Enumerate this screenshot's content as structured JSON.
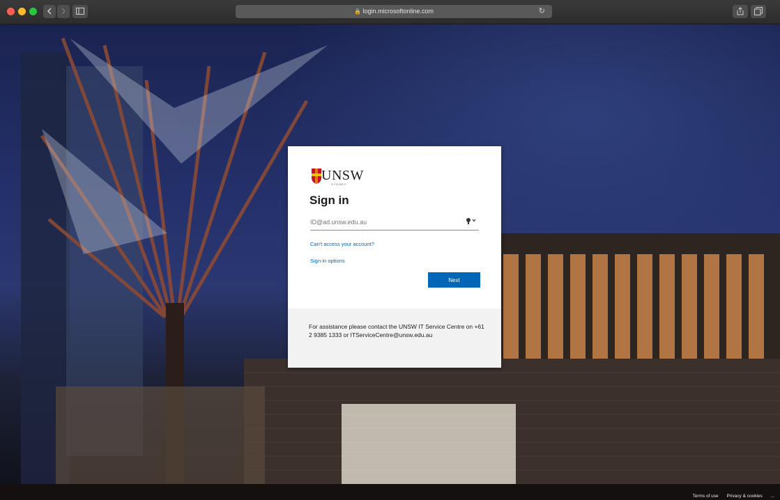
{
  "browser": {
    "url": "login.microsoftonline.com",
    "back_icon": "chevron-left",
    "forward_icon": "chevron-right",
    "sidebar_icon": "sidebar",
    "reload_icon": "reload",
    "share_icon": "share",
    "tabs_icon": "tabs"
  },
  "login": {
    "brand": "UNSW",
    "brand_sub": "SYDNEY",
    "title": "Sign in",
    "email_placeholder": "ID@ad.unsw.edu.au",
    "cant_access": "Can't access your account?",
    "signin_options": "Sign-in options",
    "next": "Next",
    "assistance": "For assistance please contact the UNSW IT Service Centre on +61 2 9385 1333 or ITServiceCentre@unsw.edu.au"
  },
  "footer": {
    "terms": "Terms of use",
    "privacy": "Privacy & cookies",
    "more": "..."
  },
  "colors": {
    "accent": "#0067b8",
    "card_footer": "#f2f2f2"
  }
}
